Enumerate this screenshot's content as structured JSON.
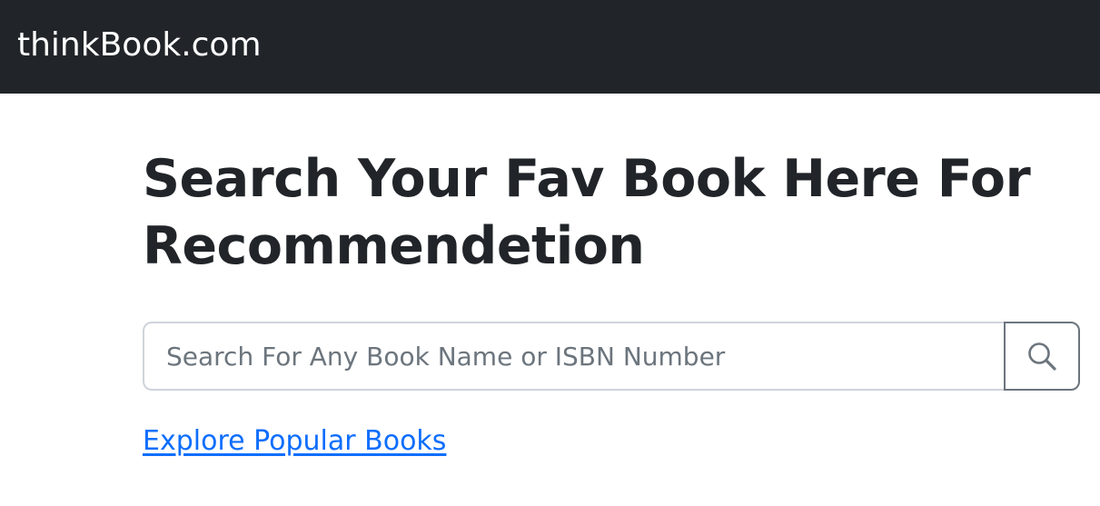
{
  "navbar": {
    "brand": "thinkBook.com"
  },
  "main": {
    "heading": "Search Your Fav Book Here For Recommendetion",
    "search": {
      "placeholder": "Search For Any Book Name or ISBN Number",
      "value": "",
      "button_icon": "search-icon"
    },
    "explore_link": "Explore Popular Books"
  },
  "colors": {
    "navbar_bg": "#212529",
    "link": "#0d6efd",
    "text": "#212529"
  }
}
